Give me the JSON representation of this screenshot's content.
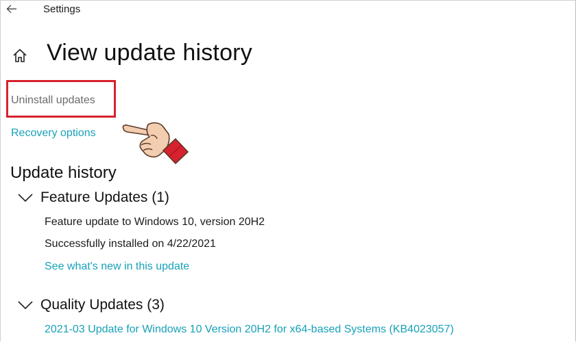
{
  "window": {
    "title": "Settings",
    "back_icon": "back-arrow-icon"
  },
  "header": {
    "home_icon": "home-icon",
    "title": "View update history"
  },
  "links": {
    "uninstall_label": "Uninstall updates",
    "recovery_label": "Recovery options"
  },
  "annotation": {
    "highlight_color": "#d7212e",
    "pointer_icon": "pointing-hand-icon"
  },
  "history": {
    "title": "Update history",
    "groups": [
      {
        "label": "Feature Updates (1)",
        "expanded": true,
        "entries": [
          {
            "name": "Feature update to Windows 10, version 20H2",
            "status": "Successfully installed on 4/22/2021",
            "link": "See what's new in this update"
          }
        ]
      },
      {
        "label": "Quality Updates (3)",
        "expanded": true,
        "entries": [
          {
            "name": "2021-03 Update for Windows 10 Version 20H2 for x64-based Systems (KB4023057)"
          }
        ]
      }
    ]
  },
  "colors": {
    "link": "#17a1b8",
    "muted_text": "#6b6b6b",
    "text": "#111111"
  }
}
